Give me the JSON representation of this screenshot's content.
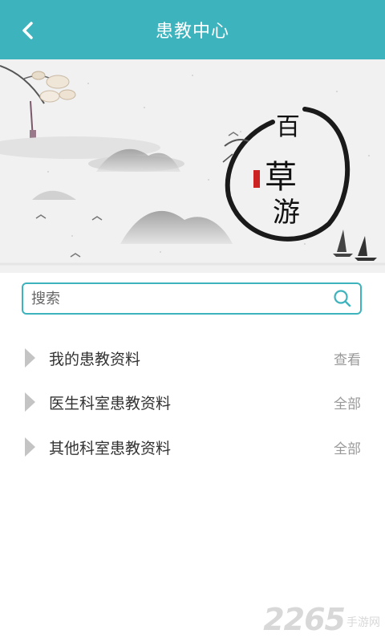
{
  "header": {
    "title": "患教中心"
  },
  "banner": {
    "calligraphy": "百草游"
  },
  "search": {
    "placeholder": "搜索"
  },
  "list": [
    {
      "label": "我的患教资料",
      "action": "查看"
    },
    {
      "label": "医生科室患教资料",
      "action": "全部"
    },
    {
      "label": "其他科室患教资料",
      "action": "全部"
    }
  ],
  "watermark": {
    "number": "2265",
    "text": "手游网"
  },
  "colors": {
    "accent": "#3db3bd"
  }
}
